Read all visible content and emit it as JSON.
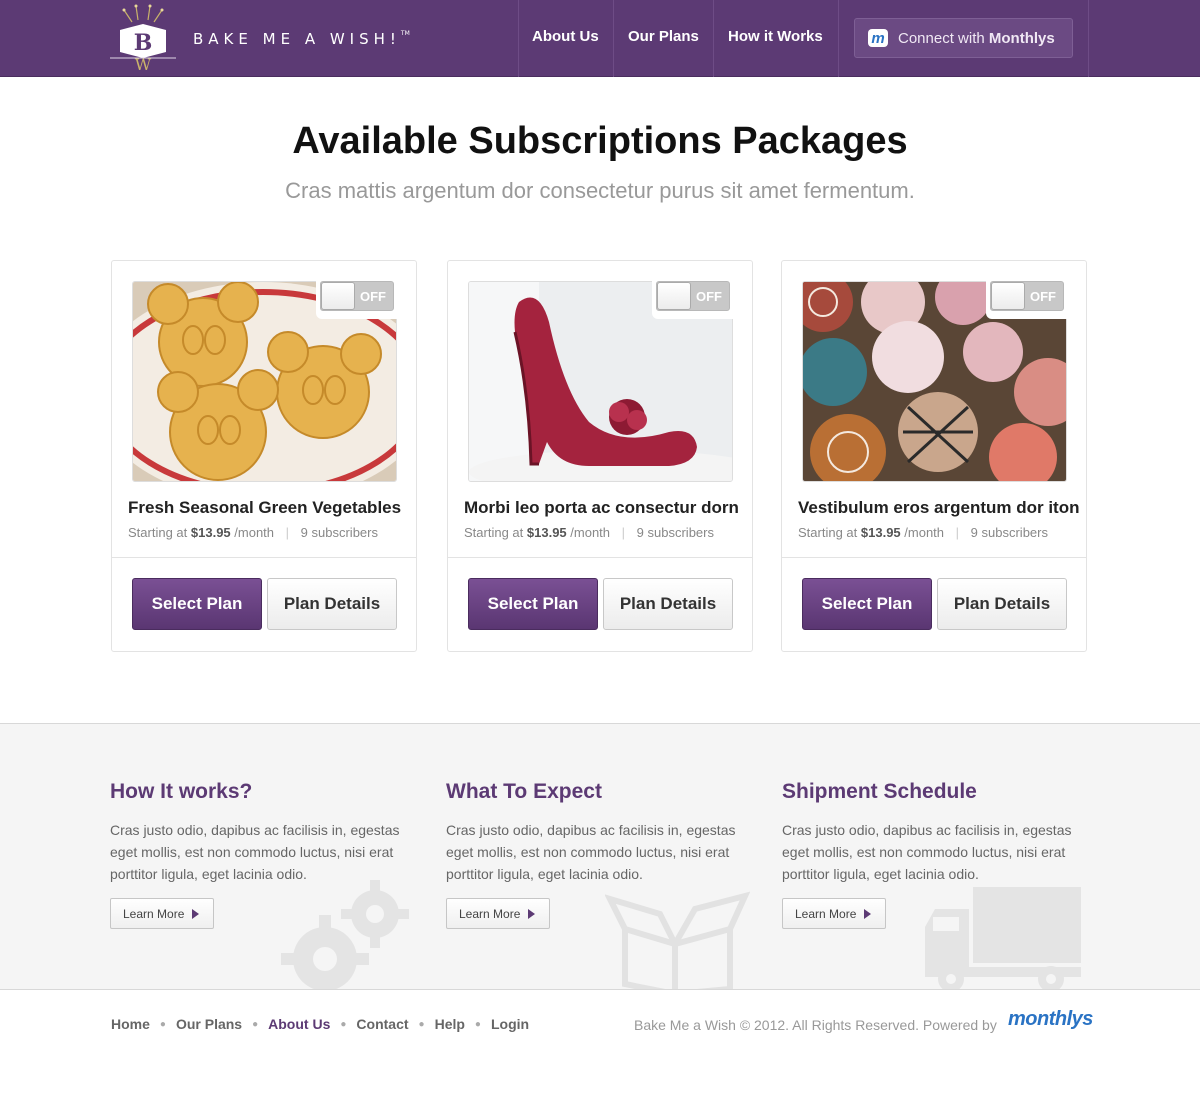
{
  "header": {
    "brand": "BAKE ME A WISH!",
    "trademark": "TM",
    "logo_letters": [
      "B",
      "W"
    ],
    "nav": [
      "About Us",
      "Our Plans",
      "How it Works"
    ],
    "connect": {
      "prefix": "Connect with",
      "name": "Monthlys",
      "icon": "m"
    }
  },
  "hero": {
    "title": "Available Subscriptions Packages",
    "subtitle": "Cras mattis  argentum dor consectetur purus sit amet fermentum."
  },
  "cards": [
    {
      "name": "Fresh Seasonal Green Vegetables",
      "price_prefix": "Starting at",
      "price": "$13.95",
      "period": "/month",
      "subscribers": "9 subscribers",
      "toggle": "OFF",
      "select": "Select Plan",
      "details": "Plan Details",
      "image": "mickey-waffles"
    },
    {
      "name": "Morbi leo porta ac consectur dorn",
      "price_prefix": "Starting at",
      "price": "$13.95",
      "period": "/month",
      "subscribers": "9 subscribers",
      "toggle": "OFF",
      "select": "Select Plan",
      "details": "Plan Details",
      "image": "red-high-heel"
    },
    {
      "name": "Vestibulum eros argentum dor iton",
      "price_prefix": "Starting at",
      "price": "$13.95",
      "period": "/month",
      "subscribers": "9 subscribers",
      "toggle": "OFF",
      "select": "Select Plan",
      "details": "Plan Details",
      "image": "designer-cupcakes"
    }
  ],
  "info": [
    {
      "title": "How It works?",
      "text": "Cras justo odio, dapibus ac facilisis in, egestas eget mollis, est non commodo luctus, nisi erat porttitor ligula, eget lacinia odio.",
      "button": "Learn More",
      "illustration": "gears-icon"
    },
    {
      "title": "What To Expect",
      "text": "Cras justo odio, dapibus ac facilisis in, egestas eget mollis, est non commodo luctus, nisi erat porttitor ligula, eget lacinia odio.",
      "button": "Learn More",
      "illustration": "open-box-icon"
    },
    {
      "title": "Shipment Schedule",
      "text": "Cras justo odio, dapibus ac facilisis in, egestas eget mollis, est non commodo luctus, nisi erat porttitor ligula, eget lacinia odio.",
      "button": "Learn More",
      "illustration": "truck-icon"
    }
  ],
  "footer": {
    "links": [
      "Home",
      "Our Plans",
      "About Us",
      "Contact",
      "Help",
      "Login"
    ],
    "active": "About Us",
    "copyright": "Bake Me a Wish © 2012. All Rights Reserved. Powered by",
    "powered_logo": "monthlys"
  },
  "colors": {
    "brand_purple": "#5c3a74",
    "monthlys_blue": "#2a73c4"
  }
}
